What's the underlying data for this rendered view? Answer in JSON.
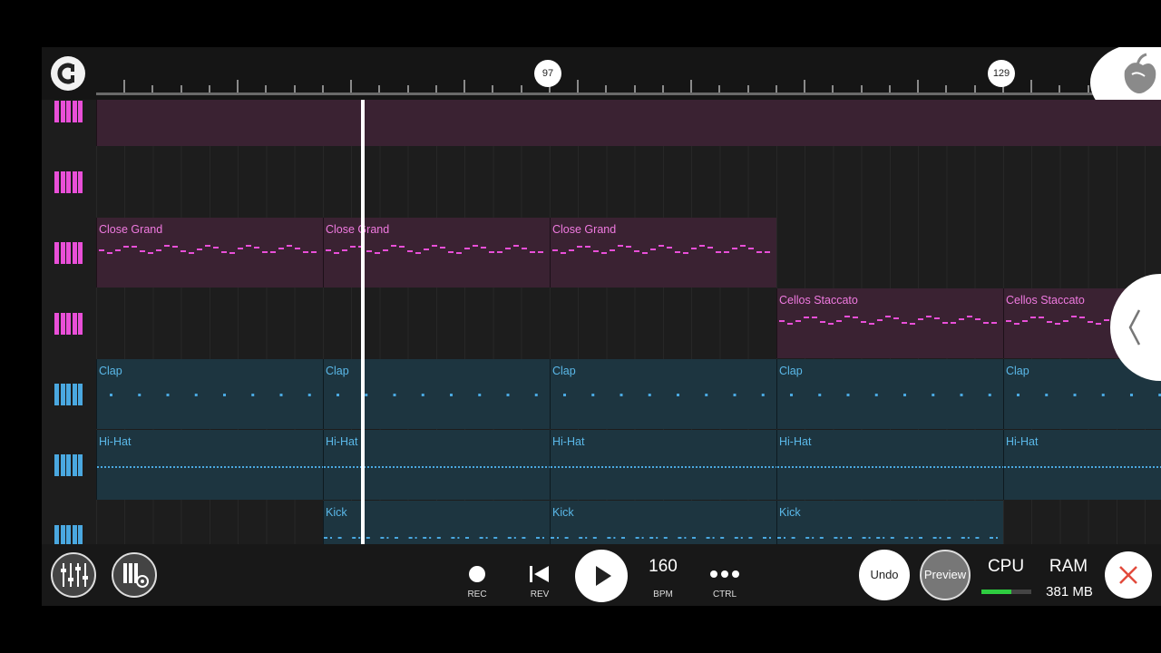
{
  "ruler": {
    "markers": [
      "97",
      "129"
    ]
  },
  "tracks": [
    {
      "color": "pink",
      "clips": []
    },
    {
      "color": "pink",
      "clips": []
    },
    {
      "color": "pink",
      "clips": [
        {
          "label": "Close Grand"
        },
        {
          "label": "Close Grand"
        },
        {
          "label": "Close Grand"
        }
      ]
    },
    {
      "color": "pink",
      "clips": [
        {
          "label": "Cellos Staccato"
        },
        {
          "label": "Cellos Staccato"
        }
      ]
    },
    {
      "color": "blue",
      "clips": [
        {
          "label": "Clap"
        },
        {
          "label": "Clap"
        },
        {
          "label": "Clap"
        },
        {
          "label": "Clap"
        },
        {
          "label": "Clap"
        }
      ]
    },
    {
      "color": "blue",
      "clips": [
        {
          "label": "Hi-Hat"
        },
        {
          "label": "Hi-Hat"
        },
        {
          "label": "Hi-Hat"
        },
        {
          "label": "Hi-Hat"
        },
        {
          "label": "Hi-Hat"
        }
      ]
    },
    {
      "color": "blue",
      "clips": [
        {
          "label": "Kick"
        },
        {
          "label": "Kick"
        },
        {
          "label": "Kick"
        }
      ]
    }
  ],
  "transport": {
    "rec_label": "REC",
    "rev_label": "REV",
    "tempo_value": "160",
    "bpm_label": "BPM",
    "ctrl_label": "CTRL",
    "undo_label": "Undo",
    "preview_label": "Preview",
    "cpu_label": "CPU",
    "cpu_level": 0.6,
    "ram_label": "RAM",
    "ram_value": "381 MB"
  },
  "colors": {
    "pink": "#e94fd8",
    "blue": "#4aa8e0",
    "cpu_green": "#2ecc40"
  }
}
